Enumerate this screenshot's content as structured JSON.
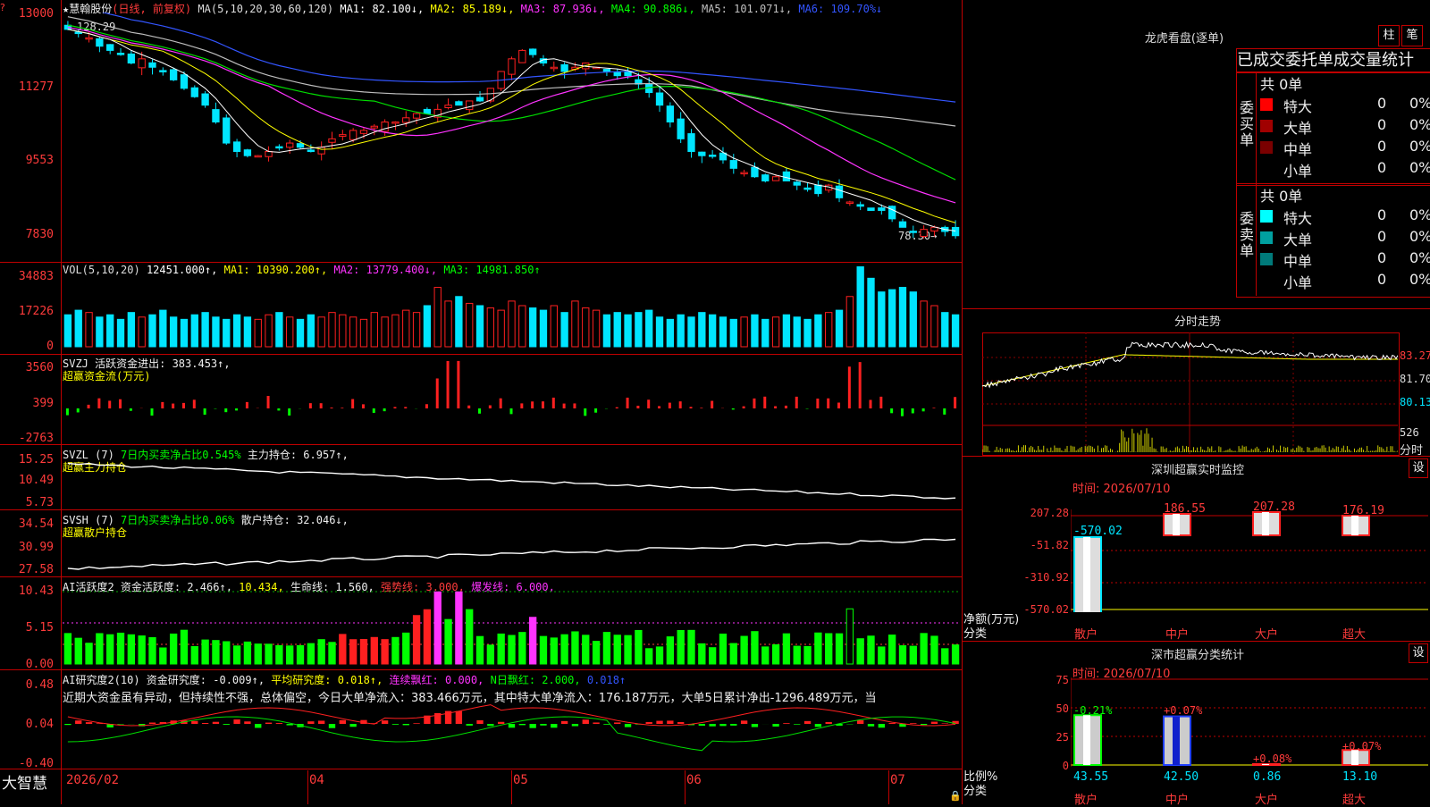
{
  "stock": {
    "name": "慧翰股份",
    "mode": "(日线, 前复权)"
  },
  "main_header": {
    "ma_def": "MA(5,10,20,30,60,120)",
    "ma1": "MA1: 82.100↓,",
    "ma2": "MA2: 85.189↓,",
    "ma3": "MA3: 87.936↓,",
    "ma4": "MA4: 90.886↓,",
    "ma5": "MA5: 101.071↓,",
    "ma6": "MA6: 109.70%↓"
  },
  "price_axis": [
    "13000",
    "11277",
    "9553",
    "7830"
  ],
  "price_marks": {
    "high": "128.29",
    "low": "78.30→"
  },
  "vol_header": {
    "def": "VOL(5,10,20)",
    "vol": "12451.000↑,",
    "ma1": "MA1: 10390.200↑,",
    "ma2": "MA2: 13779.400↓,",
    "ma3": "MA3: 14981.850↑"
  },
  "vol_axis": [
    "34883",
    "17226",
    "0"
  ],
  "svzj": {
    "line1": "SVZJ  活跃资金进出: 383.453↑,",
    "line2": "超赢资金流(万元)",
    "axis": [
      "3560",
      "399",
      "-2763"
    ]
  },
  "svzl": {
    "line1a": "SVZL (7)",
    "line1b": "7日内买卖净占比0.545%",
    "line1c": "主力持仓: 6.957↑,",
    "line2": "超赢主力持仓",
    "axis": [
      "15.25",
      "10.49",
      "5.73"
    ]
  },
  "svsh": {
    "line1a": "SVSH (7)",
    "line1b": "7日内买卖净占比0.06%",
    "line1c": "散户持仓: 32.046↓,",
    "line2": "超赢散户持仓",
    "axis": [
      "34.54",
      "30.99",
      "27.58"
    ]
  },
  "ai_act": {
    "a": "AI活跃度2 资金活跃度: 2.466↑,",
    "b": "10.434,",
    "c": "生命线: 1.560,",
    "d": "强势线: 3.000,",
    "e": "爆发线: 6.000,",
    "axis": [
      "10.43",
      "5.15",
      "0.00"
    ]
  },
  "ai_res": {
    "a": "AI研究度2(10) 资金研究度: -0.009↑,",
    "b": "平均研究度: 0.018↑,",
    "c": "连续飘红: 0.000,",
    "d": "N日飘红: 2.000,",
    "e": "0.018↑",
    "text": "近期大资金虽有异动，但持续性不强，总体偏空，今日大单净流入：383.466万元，其中特大单净流入：176.187万元，大单5日累计净出-1296.489万元，当",
    "axis": [
      "0.48",
      "0.04",
      "-0.40"
    ]
  },
  "x_axis": {
    "brand": "大智慧",
    "labels": [
      "2026/02",
      "04",
      "05",
      "06",
      "07"
    ]
  },
  "right": {
    "lhb_title": "龙虎看盘(逐单)",
    "btn1": "柱",
    "btn2": "笔",
    "tabs_title": "已成交委托单成交量统计",
    "buy": {
      "side": "委买单",
      "total": "共 0单",
      "rows": [
        {
          "label": "特大",
          "num": "0",
          "pct": "0%"
        },
        {
          "label": "大单",
          "num": "0",
          "pct": "0%"
        },
        {
          "label": "中单",
          "num": "0",
          "pct": "0%"
        },
        {
          "label": "小单",
          "num": "0",
          "pct": "0%"
        }
      ]
    },
    "sell": {
      "side": "委卖单",
      "total": "共 0单",
      "rows": [
        {
          "label": "特大",
          "num": "0",
          "pct": "0%"
        },
        {
          "label": "大单",
          "num": "0",
          "pct": "0%"
        },
        {
          "label": "中单",
          "num": "0",
          "pct": "0%"
        },
        {
          "label": "小单",
          "num": "0",
          "pct": "0%"
        }
      ]
    },
    "intraday_title": "分时走势",
    "intraday_axis": [
      "83.27",
      "81.70",
      "80.13"
    ],
    "intraday_vol": "526",
    "intraday_unit": "分时",
    "monitor_title": "深圳超赢实时监控",
    "monitor_btn": "设",
    "monitor_time": "时间: 2026/07/10",
    "monitor_axis": [
      "207.28",
      "-51.82",
      "-310.92",
      "-570.02"
    ],
    "monitor_vals": [
      "-570.02",
      "186.55",
      "207.28",
      "176.19"
    ],
    "monitor_ylab": "净额(万元)",
    "monitor_xlab": "分类",
    "cats": [
      "散户",
      "中户",
      "大户",
      "超大"
    ],
    "class_title": "深市超赢分类统计",
    "class_btn": "设",
    "class_time": "时间: 2026/07/10",
    "class_axis": [
      "75",
      "50",
      "25",
      "0"
    ],
    "class_top": [
      "-0.21%",
      "+0.07%",
      "+0.08%",
      "+0.07%"
    ],
    "class_bottom": [
      "43.55",
      "42.50",
      "0.86",
      "13.10"
    ],
    "class_ylab": "比例%",
    "class_xlab": "分类"
  },
  "chart_data": {
    "type": "candlestick",
    "title": "慧翰股份 (日线, 前复权)",
    "close": [
      12.8,
      12.7,
      12.6,
      12.4,
      12.3,
      12.2,
      12.0,
      12.1,
      11.9,
      11.8,
      11.6,
      11.4,
      11.2,
      11.0,
      10.6,
      10.1,
      9.9,
      9.8,
      9.8,
      9.9,
      10.0,
      10.1,
      10.0,
      9.9,
      10.0,
      10.2,
      10.3,
      10.4,
      10.4,
      10.5,
      10.6,
      10.6,
      10.7,
      10.8,
      10.8,
      10.9,
      11.0,
      11.0,
      11.1,
      11.1,
      11.4,
      11.8,
      12.1,
      12.3,
      12.2,
      12.0,
      11.9,
      11.8,
      11.9,
      12.0,
      11.9,
      11.8,
      11.7,
      11.7,
      11.5,
      11.3,
      11.0,
      10.6,
      10.2,
      9.9,
      9.8,
      9.8,
      9.7,
      9.5,
      9.4,
      9.3,
      9.2,
      9.3,
      9.2,
      9.1,
      9.0,
      8.9,
      9.1,
      8.8,
      8.7,
      8.6,
      8.5,
      8.5,
      8.3,
      8.1,
      8.0,
      8.05,
      8.1,
      8.0,
      7.9
    ],
    "volume": [
      14,
      16,
      15,
      13,
      14,
      12,
      15,
      13,
      14,
      16,
      13,
      12,
      14,
      15,
      13,
      12,
      14,
      13,
      12,
      14,
      15,
      13,
      12,
      14,
      13,
      15,
      14,
      13,
      12,
      15,
      13,
      14,
      16,
      15,
      18,
      26,
      20,
      22,
      19,
      18,
      17,
      16,
      20,
      18,
      17,
      16,
      18,
      15,
      20,
      17,
      16,
      14,
      15,
      14,
      15,
      16,
      13,
      12,
      14,
      13,
      15,
      14,
      13,
      12,
      13,
      14,
      12,
      13,
      14,
      13,
      12,
      14,
      15,
      16,
      22,
      35,
      30,
      24,
      25,
      26,
      24,
      20,
      18,
      15,
      14
    ]
  }
}
